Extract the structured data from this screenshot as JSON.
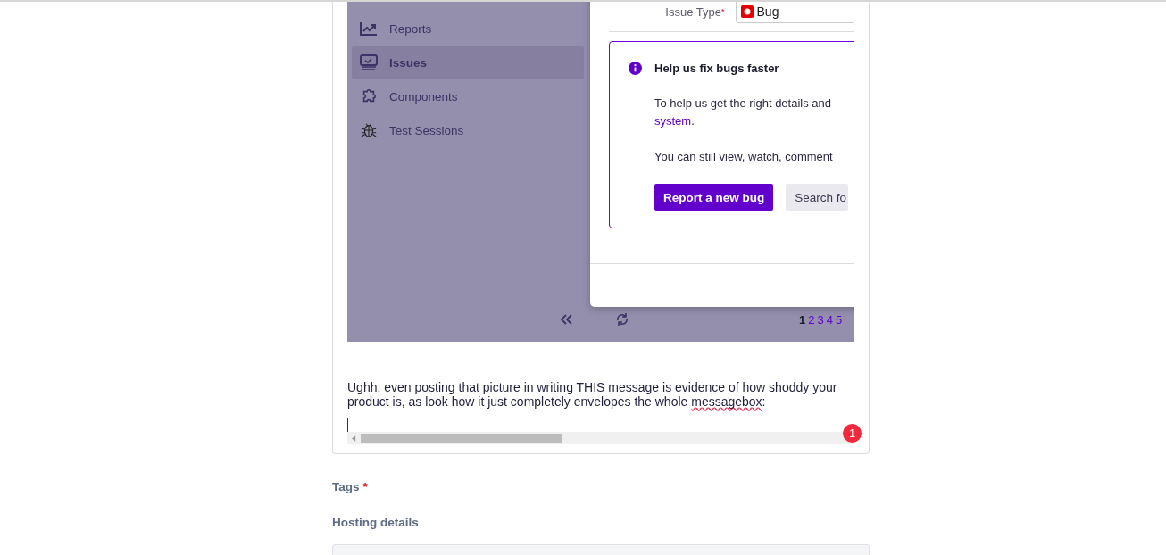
{
  "embedded_screenshot": {
    "sidebar": {
      "items": [
        {
          "label": "Reports",
          "selected": false,
          "kind": "chart"
        },
        {
          "label": "Issues",
          "selected": true,
          "kind": "monitor"
        },
        {
          "label": "Components",
          "selected": false,
          "kind": "puzzle"
        },
        {
          "label": "Test Sessions",
          "selected": false,
          "kind": "bug"
        }
      ]
    },
    "modal": {
      "issue_type_label": "Issue Type",
      "issue_type_required_mark": "*",
      "issue_type_value": "Bug",
      "notice": {
        "title": "Help us fix bugs faster",
        "line_1": "To help us get the right details and",
        "link": "system",
        "link_suffix": ".",
        "line_2": "You can still view, watch, comment",
        "buttons": [
          {
            "label": "Report a new bug",
            "kind": "primary"
          },
          {
            "label": "Search fo",
            "kind": "secondary"
          }
        ]
      }
    },
    "pager": {
      "pages": [
        {
          "label": "1",
          "selected": true
        },
        {
          "label": "2",
          "selected": false
        },
        {
          "label": "3",
          "selected": false
        },
        {
          "label": "4",
          "selected": false
        },
        {
          "label": "5",
          "selected": false
        }
      ]
    }
  },
  "message": {
    "text_before": "Ughh, even posting that picture in writing THIS message is evidence of how shoddy your product is, as look how it just completely envelopes the whole ",
    "flagged_word": "messagebox",
    "text_after": ":"
  },
  "notification_count": "1",
  "tags": {
    "label": "Tags",
    "required_mark": "*"
  },
  "hosting": {
    "label": "Hosting details"
  }
}
